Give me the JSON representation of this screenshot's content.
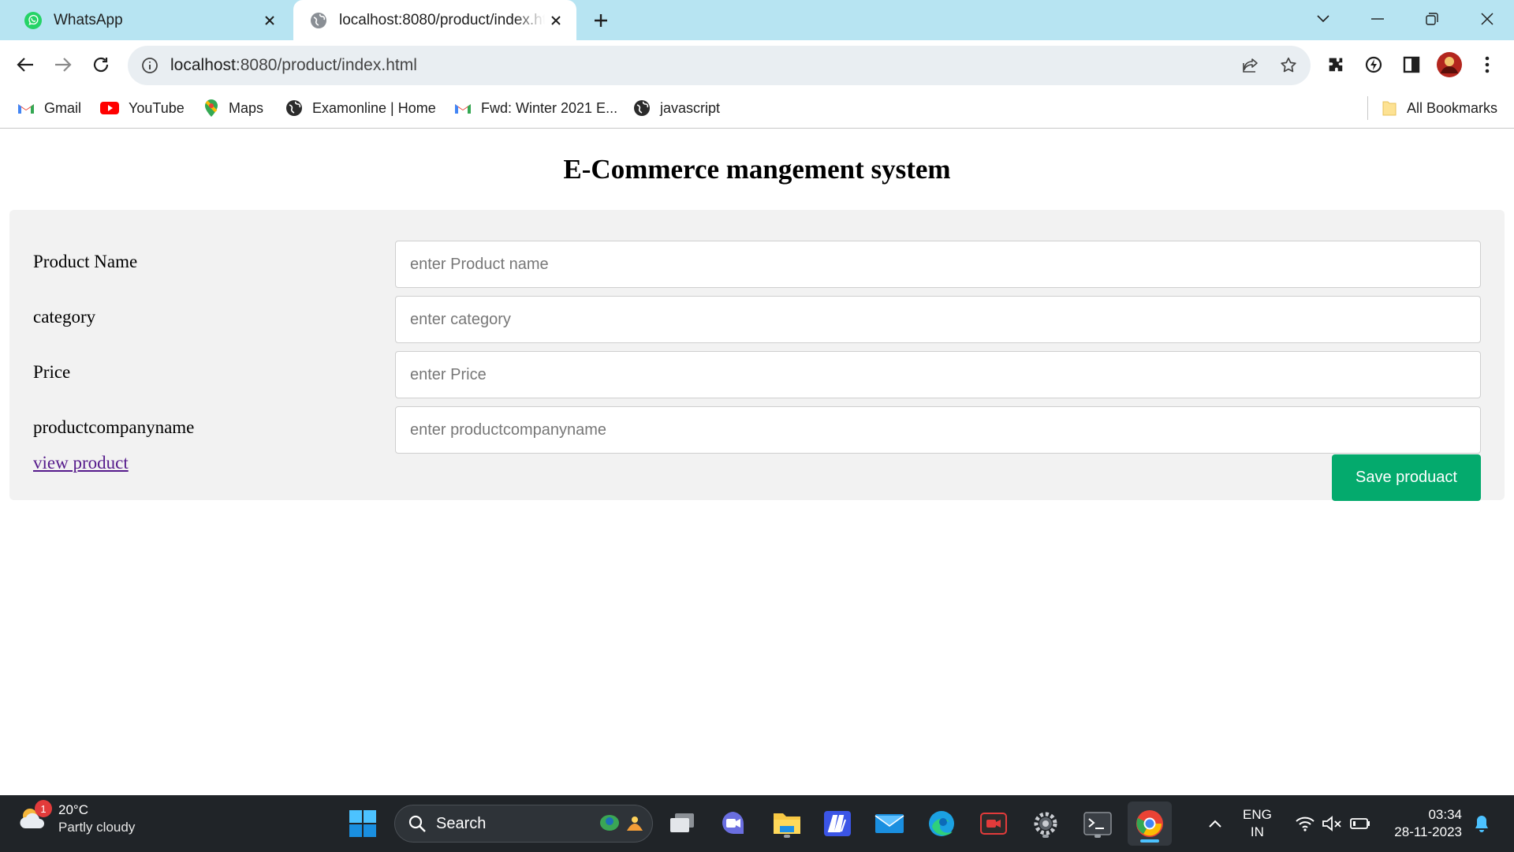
{
  "browser": {
    "tabs": [
      {
        "label": "WhatsApp",
        "icon": "whatsapp-icon",
        "active": false
      },
      {
        "label": "localhost:8080/product/index.html",
        "icon": "globe-icon",
        "active": true
      }
    ],
    "url_host": "localhost",
    "url_rest": ":8080/product/index.html",
    "bookmarks": [
      {
        "label": "Gmail",
        "icon": "gmail-icon"
      },
      {
        "label": "YouTube",
        "icon": "youtube-icon"
      },
      {
        "label": "Maps",
        "icon": "maps-icon"
      },
      {
        "label": "Examonline | Home",
        "icon": "globe-icon"
      },
      {
        "label": "Fwd: Winter 2021 E...",
        "icon": "gmail-icon"
      },
      {
        "label": "javascript",
        "icon": "globe-icon"
      }
    ],
    "all_bookmarks": "All Bookmarks"
  },
  "page": {
    "title": "E-Commerce mangement system",
    "fields": [
      {
        "label": "Product Name",
        "placeholder": "enter Product name"
      },
      {
        "label": "category",
        "placeholder": "enter category"
      },
      {
        "label": "Price",
        "placeholder": "enter Price"
      },
      {
        "label": "productcompanyname",
        "placeholder": "enter productcompanyname"
      }
    ],
    "view_link": "view product",
    "save_button": "Save produact",
    "accent_color": "#04aa6d"
  },
  "taskbar": {
    "weather_temp": "20°C",
    "weather_cond": "Partly cloudy",
    "weather_badge": "1",
    "search_label": "Search",
    "lang_top": "ENG",
    "lang_bottom": "IN",
    "time": "03:34",
    "date": "28-11-2023"
  }
}
